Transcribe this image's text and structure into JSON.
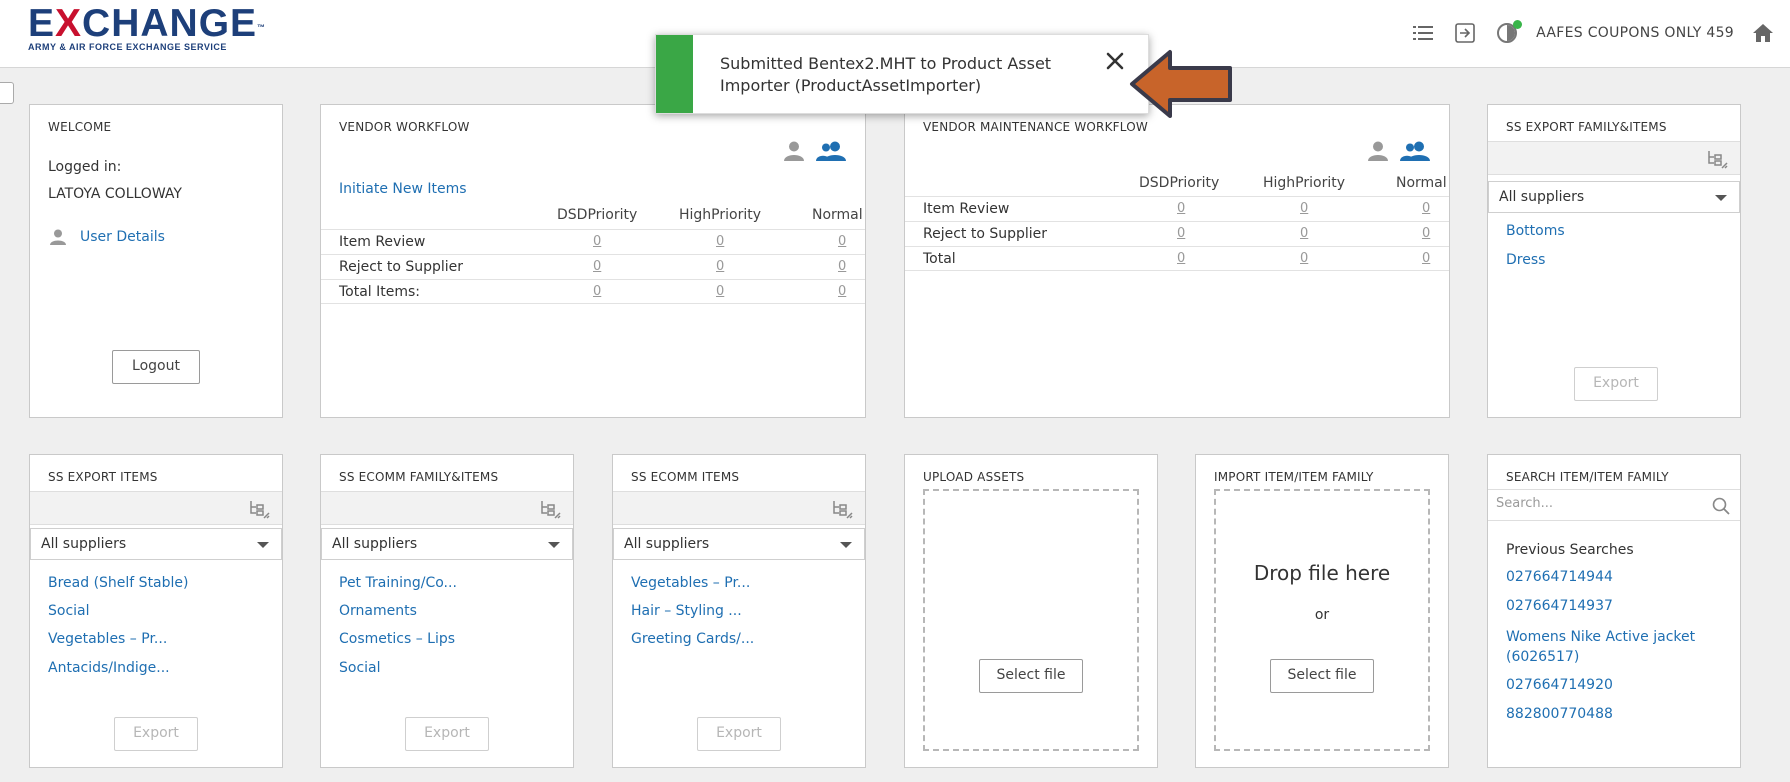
{
  "header": {
    "logo_main_a": "E",
    "logo_main_x": "X",
    "logo_main_b": "CHANGE",
    "logo_tm": "™",
    "logo_sub": "ARMY & AIR FORCE EXCHANGE SERVICE",
    "account_label": "AAFES COUPONS ONLY 459",
    "icons": [
      "list-icon",
      "sign-out-icon",
      "status-icon",
      "home-icon"
    ]
  },
  "toast": {
    "message": "Submitted Bentex2.MHT to Product Asset Importer (ProductAssetImporter)",
    "accent_color": "#3aa746"
  },
  "welcome": {
    "title": "WELCOME",
    "logged_in_label": "Logged in:",
    "user_name": "LATOYA COLLOWAY",
    "user_details_link": "User Details",
    "logout_label": "Logout"
  },
  "vendor_workflow": {
    "title": "VENDOR WORKFLOW",
    "initiate_link": "Initiate New Items",
    "columns": [
      "DSDPriority",
      "HighPriority",
      "Normal"
    ],
    "rows": [
      {
        "label": "Item Review",
        "values": [
          "0",
          "0",
          "0"
        ]
      },
      {
        "label": "Reject to Supplier",
        "values": [
          "0",
          "0",
          "0"
        ]
      },
      {
        "label": "Total Items:",
        "values": [
          "0",
          "0",
          "0"
        ]
      }
    ]
  },
  "vendor_maintenance": {
    "title": "VENDOR MAINTENANCE WORKFLOW",
    "columns": [
      "DSDPriority",
      "HighPriority",
      "Normal"
    ],
    "rows": [
      {
        "label": "Item Review",
        "values": [
          "0",
          "0",
          "0"
        ]
      },
      {
        "label": "Reject to Supplier",
        "values": [
          "0",
          "0",
          "0"
        ]
      },
      {
        "label": "Total",
        "values": [
          "0",
          "0",
          "0"
        ]
      }
    ]
  },
  "ss_export_family": {
    "title": "SS EXPORT FAMILY&ITEMS",
    "select_value": "All suppliers",
    "items": [
      "Bottoms",
      "Dress"
    ],
    "export_label": "Export"
  },
  "ss_export_items": {
    "title": "SS EXPORT ITEMS",
    "select_value": "All suppliers",
    "items": [
      "Bread (Shelf Stable)",
      "Social",
      "Vegetables – Pr...",
      "Antacids/Indige..."
    ],
    "export_label": "Export"
  },
  "ss_ecomm_family": {
    "title": "SS ECOMM FAMILY&ITEMS",
    "select_value": "All suppliers",
    "items": [
      "Pet Training/Co...",
      "Ornaments",
      "Cosmetics – Lips",
      "Social"
    ],
    "export_label": "Export"
  },
  "ss_ecomm_items": {
    "title": "SS ECOMM ITEMS",
    "select_value": "All suppliers",
    "items": [
      "Vegetables – Pr...",
      "Hair – Styling ...",
      "Greeting Cards/..."
    ],
    "export_label": "Export"
  },
  "upload_assets": {
    "title": "UPLOAD ASSETS",
    "select_file_label": "Select file"
  },
  "import_item": {
    "title": "IMPORT ITEM/ITEM FAMILY",
    "drop_text": "Drop file here",
    "or_text": "or",
    "select_file_label": "Select file"
  },
  "search_item": {
    "title": "SEARCH ITEM/ITEM FAMILY",
    "placeholder": "Search...",
    "previous_label": "Previous Searches",
    "previous": [
      "027664714944",
      "027664714937",
      "Womens Nike Active jacket (6026517)",
      "027664714920",
      "882800770488"
    ]
  },
  "colors": {
    "brand_blue": "#1d3f7a",
    "brand_red": "#c8102e",
    "link_blue": "#1f6fb2",
    "annotation_arrow": "#c8642a"
  }
}
